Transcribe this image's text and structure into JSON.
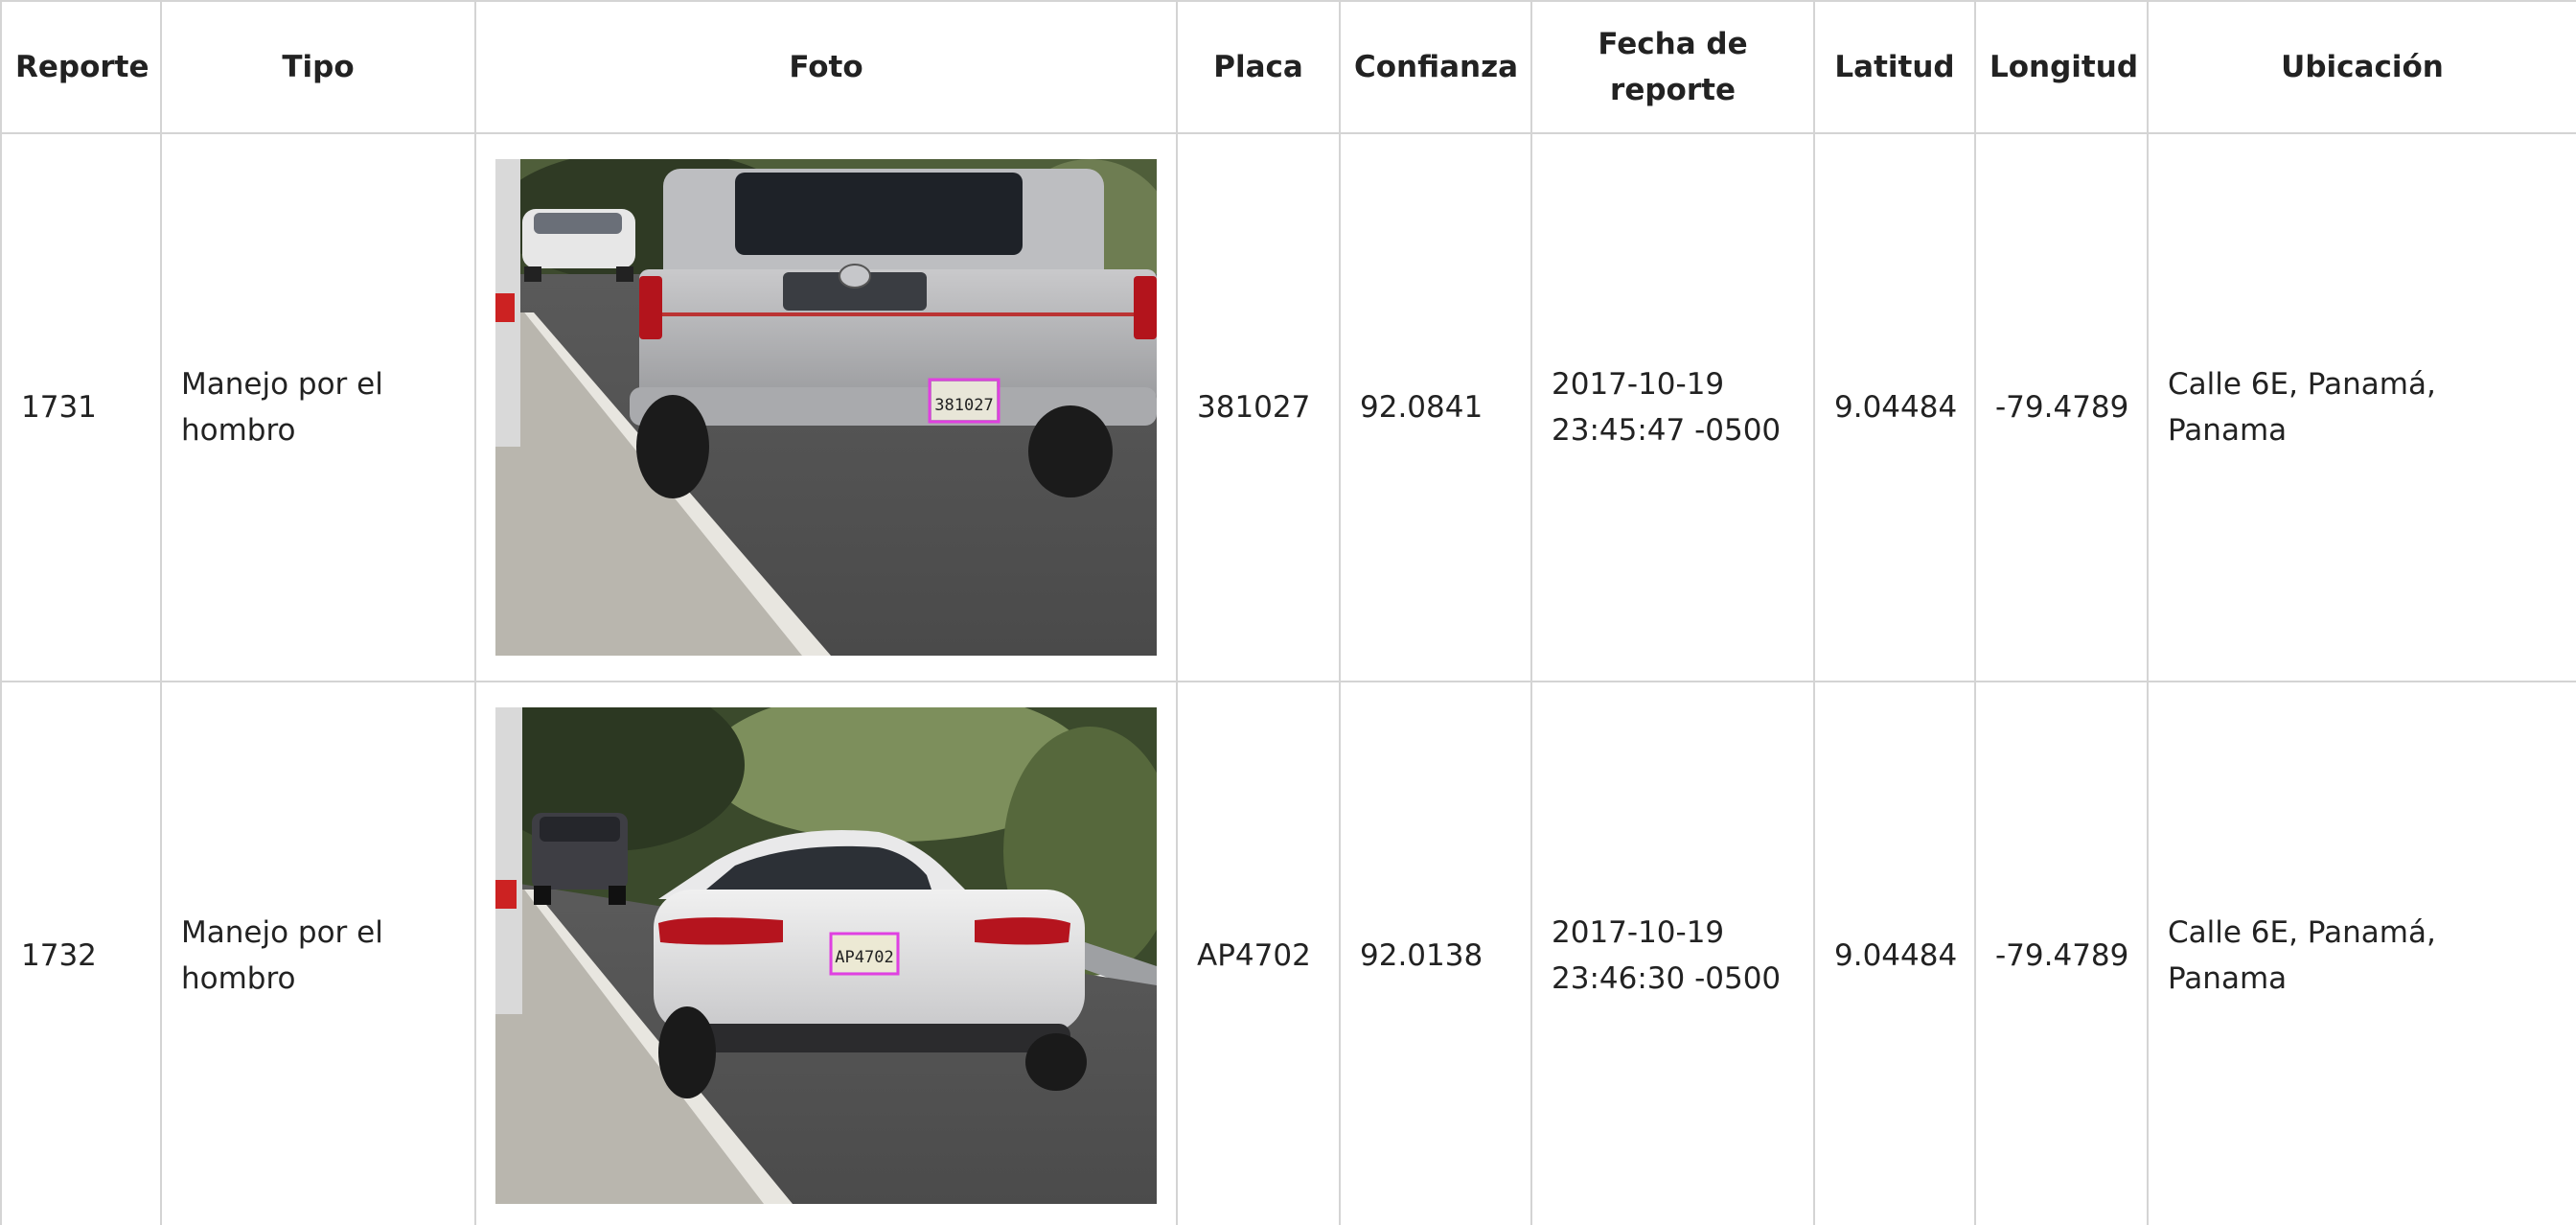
{
  "table": {
    "headers": {
      "reporte": "Reporte",
      "tipo": "Tipo",
      "foto": "Foto",
      "placa": "Placa",
      "confianza": "Confianza",
      "fecha_line1": "Fecha de",
      "fecha_line2": "reporte",
      "latitud": "Latitud",
      "longitud": "Longitud",
      "ubicacion": "Ubicación"
    },
    "rows": [
      {
        "reporte": "1731",
        "tipo": "Manejo por el hombro",
        "photo_plate": "381027",
        "placa": "381027",
        "confianza": "92.0841",
        "fecha_date": "2017-10-19",
        "fecha_time": "23:45:47 -0500",
        "latitud": "9.04484",
        "longitud": "-79.4789",
        "ubicacion": "Calle 6E, Panamá, Panama"
      },
      {
        "reporte": "1732",
        "tipo": "Manejo por el hombro",
        "photo_plate": "AP4702",
        "placa": "AP4702",
        "confianza": "92.0138",
        "fecha_date": "2017-10-19",
        "fecha_time": "23:46:30 -0500",
        "latitud": "9.04484",
        "longitud": "-79.4789",
        "ubicacion": "Calle 6E, Panamá, Panama"
      }
    ]
  },
  "colors": {
    "border": "#d4d4d4",
    "text": "#222222",
    "plate_box": "#e040e0"
  }
}
